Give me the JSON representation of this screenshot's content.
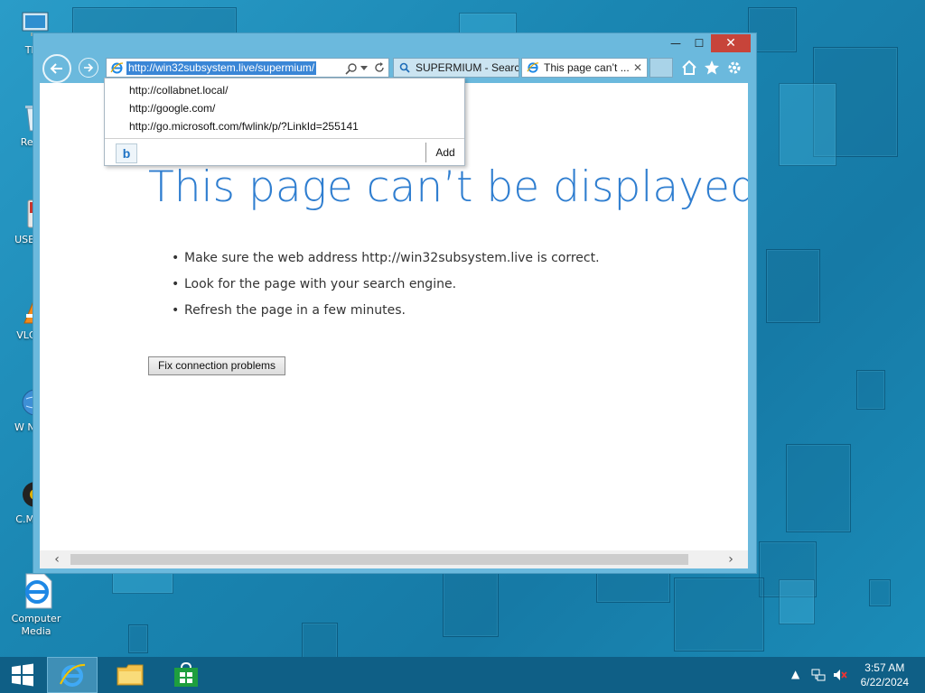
{
  "desktop": {
    "icons": [
      {
        "label": "This",
        "icon": "computer-icon"
      },
      {
        "label": "Recyc",
        "icon": "recycle-bin-icon"
      },
      {
        "label": "USB Sec",
        "icon": "usb-security-icon"
      },
      {
        "label": "VLC plа",
        "icon": "vlc-icon"
      },
      {
        "label": "W Navig",
        "icon": "globe-icon"
      },
      {
        "label": "C.M Pak",
        "icon": "cm-icon"
      },
      {
        "label": "Computer Media",
        "icon": "ie-file-icon"
      }
    ]
  },
  "browser": {
    "address_url": "http://win32subsystem.live/supermium/",
    "tabs": [
      {
        "label": "SUPERMIUM - Search",
        "icon": "search-icon"
      },
      {
        "label": "This page can’t ...",
        "icon": "ie-icon"
      }
    ],
    "window_controls": {
      "minimize": "—",
      "maximize": "☐",
      "close": "✕"
    },
    "toolbar_icons": [
      "home-icon",
      "favorites-star-icon",
      "settings-gear-icon"
    ],
    "dropdown": {
      "suggestions": [
        "http://collabnet.local/",
        "http://google.com/",
        "http://go.microsoft.com/fwlink/p/?LinkId=255141"
      ],
      "add_label": "Add",
      "search_provider_icon": "bing-icon"
    }
  },
  "page": {
    "title": "This page can’t be displayed",
    "bullets": [
      "Make sure the web address http://win32subsystem.live is correct.",
      "Look for the page with your search engine.",
      "Refresh the page in a few minutes."
    ],
    "fix_button": "Fix connection problems"
  },
  "taskbar": {
    "time": "3:57 AM",
    "date": "6/22/2024",
    "apps": [
      "start-icon",
      "internet-explorer-icon",
      "file-explorer-icon",
      "store-icon"
    ]
  }
}
